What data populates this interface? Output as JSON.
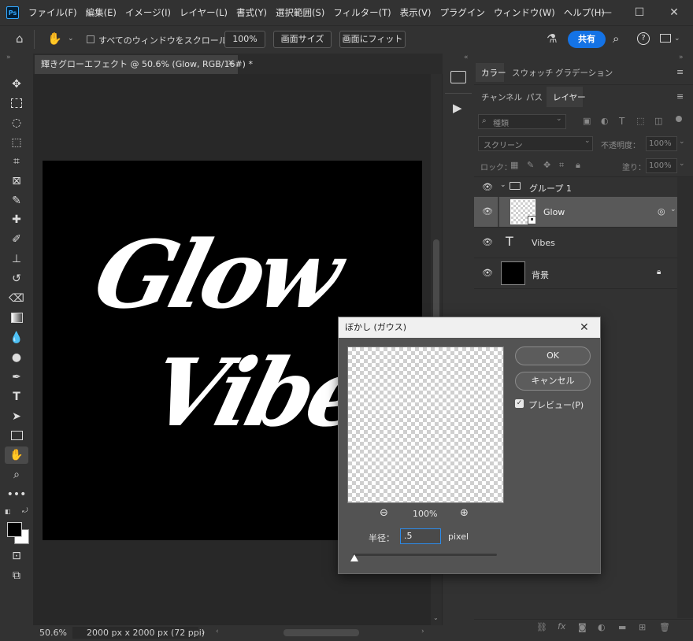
{
  "app": {
    "logo": "Ps"
  },
  "menu": [
    "ファイル(F)",
    "編集(E)",
    "イメージ(I)",
    "レイヤー(L)",
    "書式(Y)",
    "選択範囲(S)",
    "フィルター(T)",
    "表示(V)",
    "プラグイン",
    "ウィンドウ(W)",
    "ヘルプ(H)"
  ],
  "options": {
    "scroll_all_label": "すべてのウィンドウをスクロール",
    "zoom_value": "100%",
    "fit_screen_label": "画面サイズ",
    "fill_screen_label": "画面にフィット",
    "share_label": "共有"
  },
  "document": {
    "tab_title": "輝きグローエフェクト @ 50.6% (Glow, RGB/16#) *",
    "art_line1": "Glow",
    "art_line2": "Vibes"
  },
  "status": {
    "zoom": "50.6%",
    "doc_info": "2000 px x 2000 px (72 ppi)",
    "arrow": "›"
  },
  "panels": {
    "top_tabs": [
      "カラー",
      "スウォッチ",
      "グラデーション"
    ],
    "layer_tabs": [
      "チャンネル",
      "パス",
      "レイヤー"
    ],
    "search_placeholder": "種類",
    "blend_mode": "スクリーン",
    "opacity_label": "不透明度：",
    "opacity_value": "100%",
    "lock_label": "ロック：",
    "fill_label": "塗り：",
    "fill_value": "100%"
  },
  "layers": [
    {
      "name": "グループ 1",
      "type": "group"
    },
    {
      "name": "Glow",
      "type": "smart"
    },
    {
      "name": "Vibes",
      "type": "text"
    },
    {
      "name": "背景",
      "type": "background"
    }
  ],
  "dialog": {
    "title": "ぼかし (ガウス)",
    "ok_label": "OK",
    "cancel_label": "キャンセル",
    "preview_label": "プレビュー(P)",
    "preview_checked": true,
    "zoom_value": "100%",
    "radius_label": "半径：",
    "radius_value": ".5",
    "radius_unit": "pixel"
  }
}
